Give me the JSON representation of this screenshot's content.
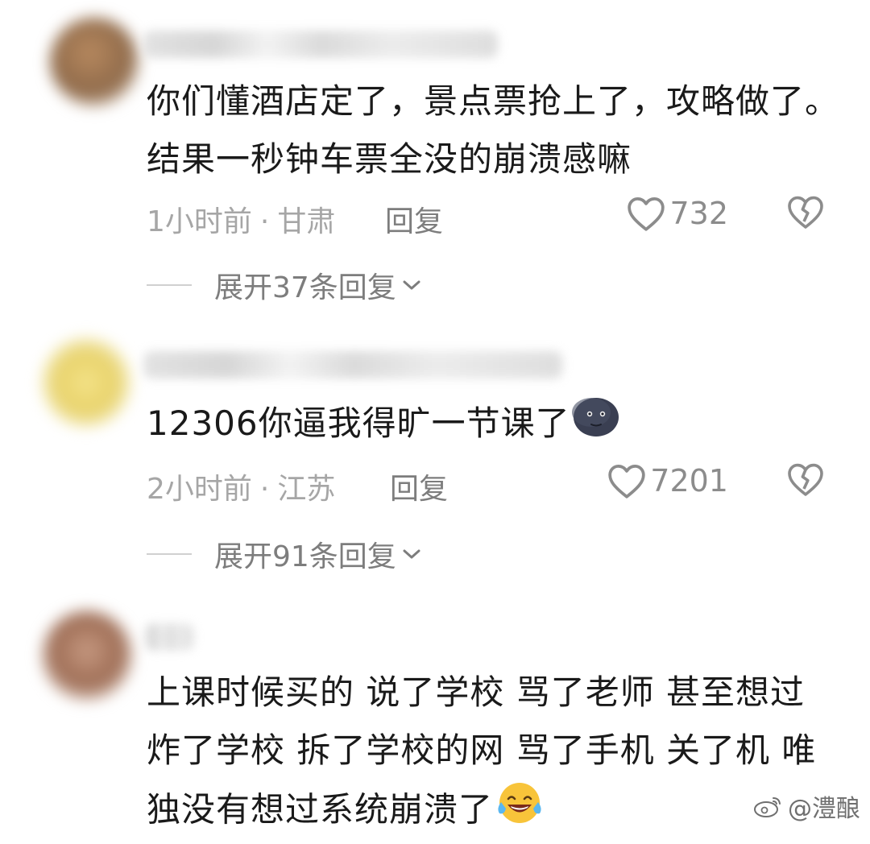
{
  "comments": [
    {
      "text": "你们懂酒店定了，景点票抢上了，攻略做了。结果一秒钟车票全没的崩溃感嘛",
      "time": "1小时前",
      "location": "甘肃",
      "reply_label": "回复",
      "likes": "732",
      "expand_label": "展开37条回复"
    },
    {
      "text": "12306你逼我得旷一节课了",
      "emoji": "new-moon-face",
      "time": "2小时前",
      "location": "江苏",
      "reply_label": "回复",
      "likes": "7201",
      "expand_label": "展开91条回复"
    },
    {
      "text": "上课时候买的 说了学校 骂了老师 甚至想过炸了学校 拆了学校的网 骂了手机 关了机 唯独没有想过系统崩溃了",
      "emoji": "tears-of-joy-face"
    }
  ],
  "meta_separator": "·",
  "watermark": {
    "handle": "@澧酿",
    "icon": "weibo-icon"
  },
  "colors": {
    "text": "#1a1a1a",
    "meta": "#a6a6a6",
    "action": "#7d7d7d",
    "icon": "#8c8c8c"
  }
}
